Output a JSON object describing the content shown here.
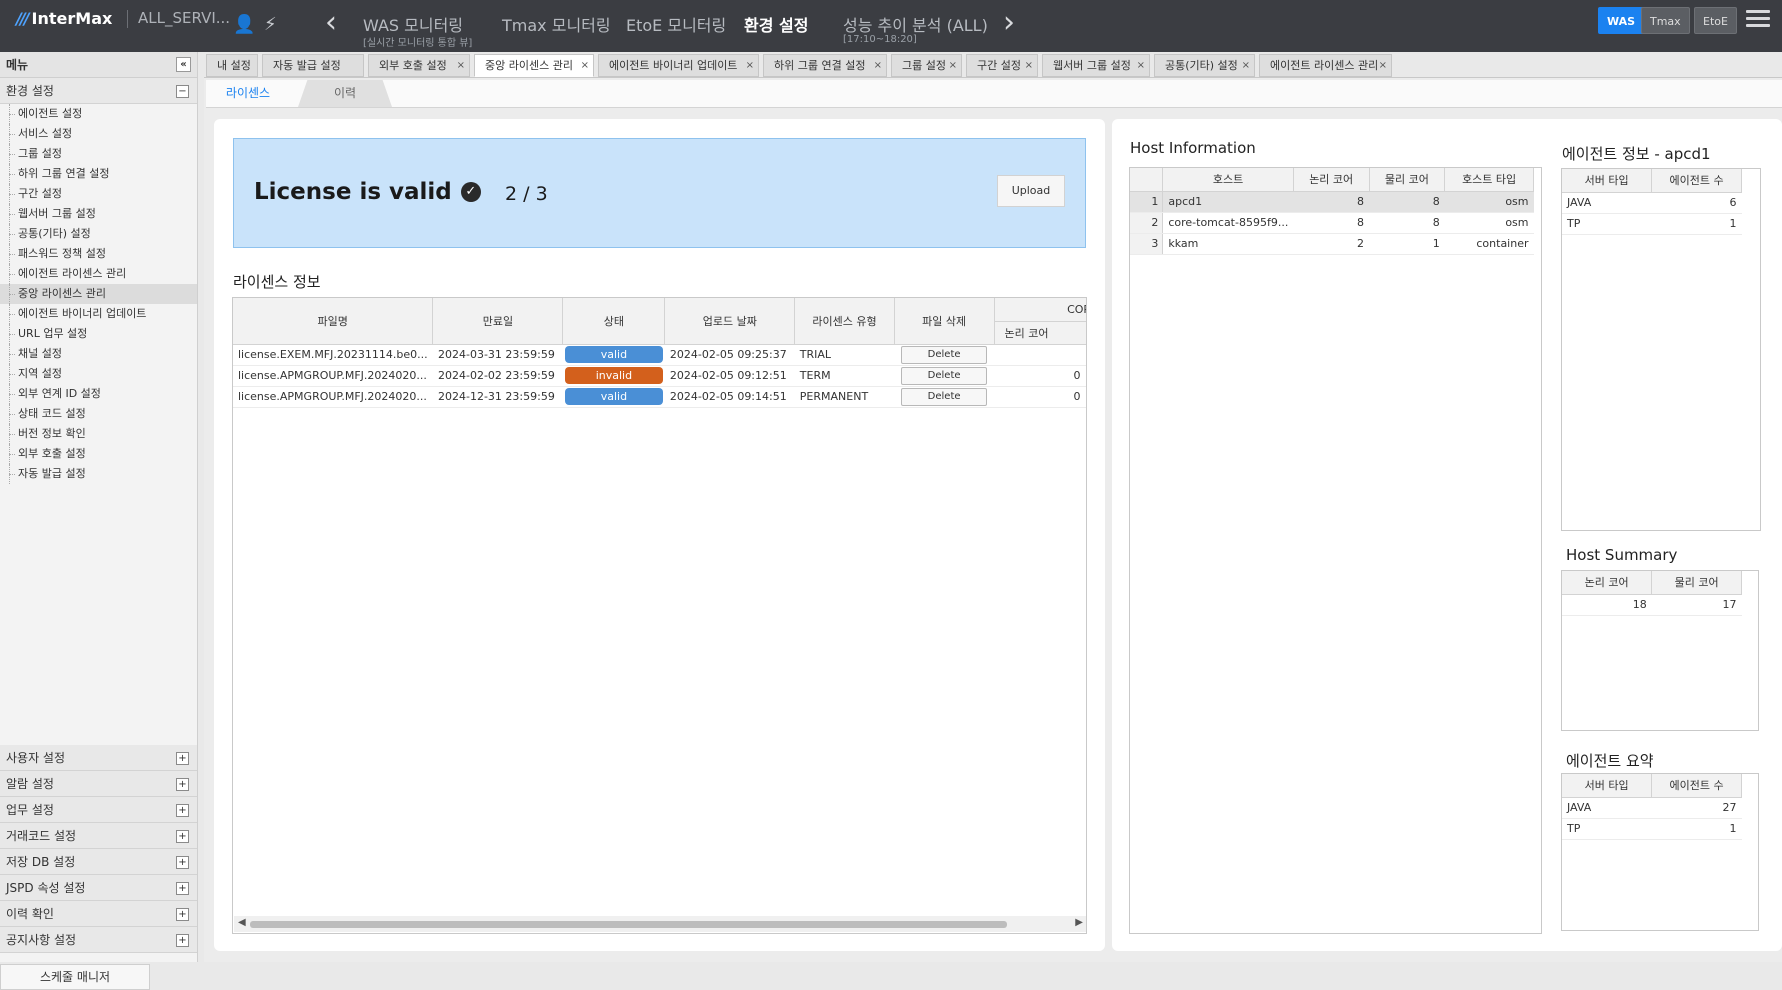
{
  "app": {
    "logo": "InterMax",
    "service": "ALL_SERVI..."
  },
  "nav": {
    "items": [
      {
        "label": "WAS 모니터링",
        "sub": "[실시간 모니터링 통합 뷰]"
      },
      {
        "label": "Tmax 모니터링"
      },
      {
        "label": "EtoE 모니터링"
      },
      {
        "label": "환경 설정"
      },
      {
        "label": "성능 추이 분석 (ALL)",
        "sub": "[17:10~18:20]"
      }
    ],
    "modes": [
      "WAS",
      "Tmax",
      "EtoE"
    ],
    "accent": "#1b82f0"
  },
  "sidebar": {
    "title": "메뉴",
    "group_env": "환경 설정",
    "items": [
      "에이전트 설정",
      "서비스 설정",
      "그룹 설정",
      "하위 그룹 연결 설정",
      "구간 설정",
      "웹서버 그룹 설정",
      "공통(기타) 설정",
      "패스워드 정책 설정",
      "에이전트 라이센스 관리",
      "중앙 라이센스 관리",
      "에이전트 바이너리 업데이트",
      "URL 업무 설정",
      "채널 설정",
      "지역 설정",
      "외부 연계 ID 설정",
      "상태 코드 설정",
      "버전 정보 확인",
      "외부 호출 설정",
      "자동 발급 설정"
    ],
    "groups": [
      "사용자 설정",
      "알람 설정",
      "업무 설정",
      "거래코드 설정",
      "저장 DB 설정",
      "JSPD 속성 설정",
      "이력 확인",
      "공지사항 설정"
    ],
    "schedule": "스케줄 매니저"
  },
  "tabs": [
    "내 설정",
    "자동 발급 설정",
    "외부 호출 설정",
    "중앙 라이센스 관리",
    "에이전트 바이너리 업데이트",
    "하위 그룹 연결 설정",
    "그룹 설정",
    "구간 설정",
    "웹서버 그룹 설정",
    "공통(기타) 설정",
    "에이전트 라이센스 관리"
  ],
  "subtabs": [
    "라이센스",
    "이력"
  ],
  "license": {
    "status_text": "License is valid",
    "count": "2 / 3",
    "upload": "Upload",
    "section_title": "라이센스 정보",
    "columns": [
      "파일명",
      "만료일",
      "상태",
      "업로드 날짜",
      "라이센스 유형",
      "파일 삭제"
    ],
    "core_group": "CORE",
    "core_sub": "논리 코어",
    "rows": [
      {
        "file": "license.EXEM.MFJ.20231114.be0...",
        "expire": "2024-03-31 23:59:59",
        "status": "valid",
        "uploaded": "2024-02-05 09:25:37",
        "type": "TRIAL",
        "delete": "Delete",
        "core": ""
      },
      {
        "file": "license.APMGROUP.MFJ.2024020...",
        "expire": "2024-02-02 23:59:59",
        "status": "invalid",
        "uploaded": "2024-02-05 09:12:51",
        "type": "TERM",
        "delete": "Delete",
        "core": "0"
      },
      {
        "file": "license.APMGROUP.MFJ.2024020...",
        "expire": "2024-12-31 23:59:59",
        "status": "valid",
        "uploaded": "2024-02-05 09:14:51",
        "type": "PERMANENT",
        "delete": "Delete",
        "core": "0"
      }
    ],
    "status_colors": {
      "valid": "#4a8fd6",
      "invalid": "#d3601c"
    }
  },
  "host_info": {
    "title": "Host Information",
    "columns": [
      "호스트",
      "논리 코어",
      "물리 코어",
      "호스트 타입"
    ],
    "rows": [
      {
        "n": "1",
        "host": "apcd1",
        "logical": "8",
        "physical": "8",
        "type": "osm"
      },
      {
        "n": "2",
        "host": "core-tomcat-8595f9...",
        "logical": "8",
        "physical": "8",
        "type": "osm"
      },
      {
        "n": "3",
        "host": "kkam",
        "logical": "2",
        "physical": "1",
        "type": "container"
      }
    ]
  },
  "agent_info": {
    "title": "에이전트 정보 - apcd1",
    "columns": [
      "서버 타입",
      "에이전트 수"
    ],
    "rows": [
      {
        "type": "JAVA",
        "count": "6"
      },
      {
        "type": "TP",
        "count": "1"
      }
    ]
  },
  "host_summary": {
    "title": "Host Summary",
    "columns": [
      "논리 코어",
      "물리 코어"
    ],
    "rows": [
      {
        "logical": "18",
        "physical": "17"
      }
    ]
  },
  "agent_summary": {
    "title": "에이전트 요약",
    "columns": [
      "서버 타입",
      "에이전트 수"
    ],
    "rows": [
      {
        "type": "JAVA",
        "count": "27"
      },
      {
        "type": "TP",
        "count": "1"
      }
    ]
  }
}
